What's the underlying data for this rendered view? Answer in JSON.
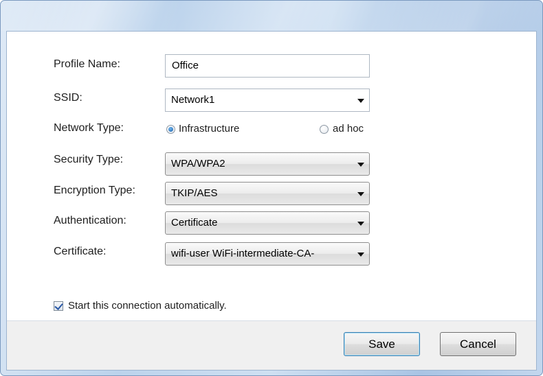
{
  "form": {
    "profile_name": {
      "label": "Profile Name:",
      "value": "Office"
    },
    "ssid": {
      "label": "SSID:",
      "value": "Network1"
    },
    "network_type": {
      "label": "Network Type:",
      "options": [
        {
          "label": "Infrastructure",
          "selected": true
        },
        {
          "label": "ad hoc",
          "selected": false
        }
      ]
    },
    "security_type": {
      "label": "Security Type:",
      "value": "WPA/WPA2"
    },
    "encryption_type": {
      "label": "Encryption Type:",
      "value": "TKIP/AES"
    },
    "authentication": {
      "label": "Authentication:",
      "value": "Certificate"
    },
    "certificate": {
      "label": "Certificate:",
      "value": "wifi-user WiFi-intermediate-CA-"
    }
  },
  "auto_connect": {
    "label": "Start this connection automatically.",
    "checked": true
  },
  "buttons": {
    "save": "Save",
    "cancel": "Cancel"
  },
  "colors": {
    "accent": "#1c5fa8",
    "titlebar": "#bcd3ec",
    "footer": "#f0f0f0"
  }
}
